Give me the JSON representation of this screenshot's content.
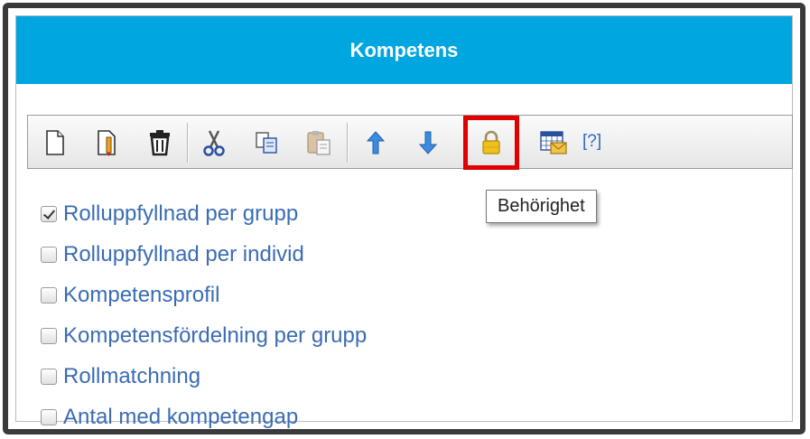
{
  "panel": {
    "title": "Kompetens"
  },
  "toolbar": {
    "buttons": [
      {
        "name": "new-icon",
        "icon": "page"
      },
      {
        "name": "edit-icon",
        "icon": "page-pencil"
      },
      {
        "name": "delete-icon",
        "icon": "trash"
      },
      {
        "name": "cut-icon",
        "icon": "scissors"
      },
      {
        "name": "copy-icon",
        "icon": "copy"
      },
      {
        "name": "paste-icon",
        "icon": "clipboard"
      },
      {
        "name": "move-up-icon",
        "icon": "arrow-up"
      },
      {
        "name": "move-down-icon",
        "icon": "arrow-down"
      },
      {
        "name": "lock-icon",
        "icon": "padlock"
      },
      {
        "name": "schedule-mail-icon",
        "icon": "calendar-envelope"
      }
    ],
    "help_label": "[?]",
    "colors": {
      "arrow": "#3d8be0",
      "lock": "#f0c020",
      "highlight": "#e00000"
    }
  },
  "tooltip": {
    "text": "Behörighet"
  },
  "items": [
    {
      "label": "Rolluppfyllnad per grupp",
      "checked": true
    },
    {
      "label": "Rolluppfyllnad per individ",
      "checked": false
    },
    {
      "label": "Kompetensprofil",
      "checked": false
    },
    {
      "label": "Kompetensfördelning per grupp",
      "checked": false
    },
    {
      "label": "Rollmatchning",
      "checked": false
    },
    {
      "label": "Antal med kompetengap",
      "checked": false
    }
  ]
}
